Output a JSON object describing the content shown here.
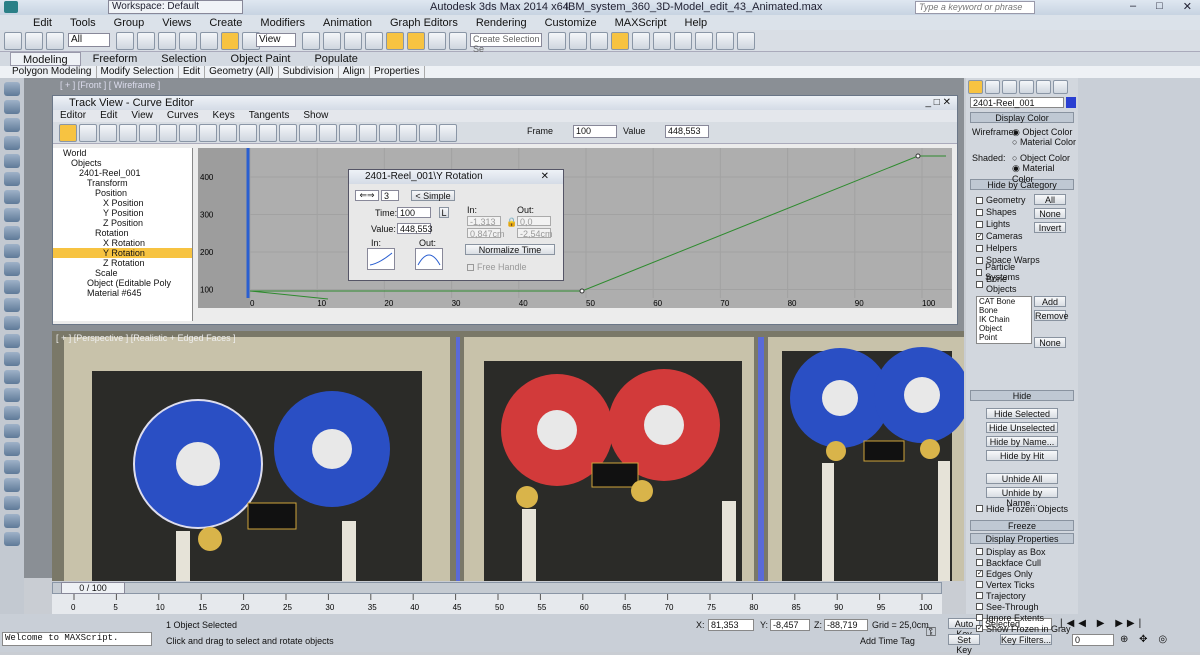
{
  "title": {
    "workspace": "Workspace: Default",
    "app": "Autodesk 3ds Max  2014 x64",
    "file": "IBM_system_360_3D-Model_edit_43_Animated.max",
    "search_placeholder": "Type a keyword or phrase"
  },
  "menu": [
    "Edit",
    "Tools",
    "Group",
    "Views",
    "Create",
    "Modifiers",
    "Animation",
    "Graph Editors",
    "Rendering",
    "Customize",
    "MAXScript",
    "Help"
  ],
  "toolbar": {
    "filter": "All",
    "refsys": "View",
    "selset": "Create Selection Se"
  },
  "ribbon": {
    "tabs": [
      "Modeling",
      "Freeform",
      "Selection",
      "Object Paint",
      "Populate"
    ],
    "sub": [
      "Polygon Modeling",
      "Modify Selection",
      "Edit",
      "Geometry (All)",
      "Subdivision",
      "Align",
      "Properties"
    ]
  },
  "vp_front_label": "[ + ] [Front ] [ Wireframe ]",
  "trackview": {
    "title": "Track View - Curve Editor",
    "menu": [
      "Editor",
      "Edit",
      "View",
      "Curves",
      "Keys",
      "Tangents",
      "Show"
    ],
    "frame_label": "Frame",
    "frame_value": "100",
    "value_label": "Value",
    "value_value": "448,553",
    "tree": [
      "World",
      "Objects",
      "2401-Reel_001",
      "Transform",
      "Position",
      "X Position",
      "Y Position",
      "Z Position",
      "Rotation",
      "X Rotation",
      "Y Rotation",
      "Z Rotation",
      "Scale",
      "Object (Editable Poly",
      "Material #645"
    ],
    "yticks": [
      "400",
      "300",
      "200",
      "100"
    ],
    "xticks": [
      "0",
      "10",
      "20",
      "30",
      "40",
      "50",
      "60",
      "70",
      "80",
      "90",
      "100"
    ]
  },
  "dialog": {
    "title": "2401-Reel_001\\Y Rotation",
    "key": "3",
    "simple": "< Simple",
    "time_label": "Time:",
    "time": "100",
    "L": "L",
    "value_label": "Value:",
    "value": "448,553",
    "in_label": "In:",
    "in_val": "-1,313",
    "in_val2": "0,847cm",
    "out_label": "Out:",
    "out_val": "0,0",
    "out_val2": "-2,54cm",
    "normalize": "Normalize Time",
    "free": "Free Handle"
  },
  "vp_persp_label": "[ + ] [Perspective ] [Realistic + Edged Faces ]",
  "timeline": {
    "slider": "0 / 100",
    "ticks": [
      "0",
      "5",
      "10",
      "15",
      "20",
      "25",
      "30",
      "35",
      "40",
      "45",
      "50",
      "55",
      "60",
      "65",
      "70",
      "75",
      "80",
      "85",
      "90",
      "95",
      "100"
    ]
  },
  "status": {
    "script": "Welcome to MAXScript.",
    "selected": "1 Object Selected",
    "prompt": "Click and drag to select and rotate objects",
    "x": "81,353",
    "y": "-8,457",
    "z": "-88,719",
    "grid": "Grid = 25,0cm",
    "addtag": "Add Time Tag",
    "autokey": "Auto Key",
    "setkey": "Set Key",
    "selected_dd": "Selected",
    "keyfilters": "Key Filters...",
    "frame": "0"
  },
  "cmd": {
    "name": "2401-Reel_001",
    "display_color": "Display Color",
    "wireframe": "Wireframe:",
    "shaded": "Shaded:",
    "object_color": "Object Color",
    "material_color": "Material Color",
    "hide_by_category": "Hide by Category",
    "cats": [
      {
        "label": "Geometry",
        "on": false
      },
      {
        "label": "Shapes",
        "on": false
      },
      {
        "label": "Lights",
        "on": false
      },
      {
        "label": "Cameras",
        "on": true
      },
      {
        "label": "Helpers",
        "on": false
      },
      {
        "label": "Space Warps",
        "on": false
      },
      {
        "label": "Particle Systems",
        "on": false
      },
      {
        "label": "Bone Objects",
        "on": false
      }
    ],
    "all": "All",
    "none": "None",
    "invert": "Invert",
    "list": [
      "CAT Bone",
      "Bone",
      "IK Chain Object",
      "Point"
    ],
    "add": "Add",
    "remove": "Remove",
    "none2": "None",
    "hide": "Hide",
    "hide_btns": [
      "Hide Selected",
      "Hide Unselected",
      "Hide by Name...",
      "Hide by Hit"
    ],
    "unhide_btns": [
      "Unhide All",
      "Unhide by Name..."
    ],
    "hide_frozen": "Hide Frozen Objects",
    "freeze": "Freeze",
    "display_props": "Display Properties",
    "props": [
      {
        "label": "Display as Box",
        "on": false
      },
      {
        "label": "Backface Cull",
        "on": false
      },
      {
        "label": "Edges Only",
        "on": true
      },
      {
        "label": "Vertex Ticks",
        "on": false
      },
      {
        "label": "Trajectory",
        "on": false
      },
      {
        "label": "See-Through",
        "on": false
      },
      {
        "label": "Ignore Extents",
        "on": false
      },
      {
        "label": "Show Frozen in Gray",
        "on": true
      }
    ]
  },
  "colors": {
    "reel_blue": "#2a4fc4",
    "reel_red": "#d23a3a",
    "curve": "#2e8b2e"
  }
}
